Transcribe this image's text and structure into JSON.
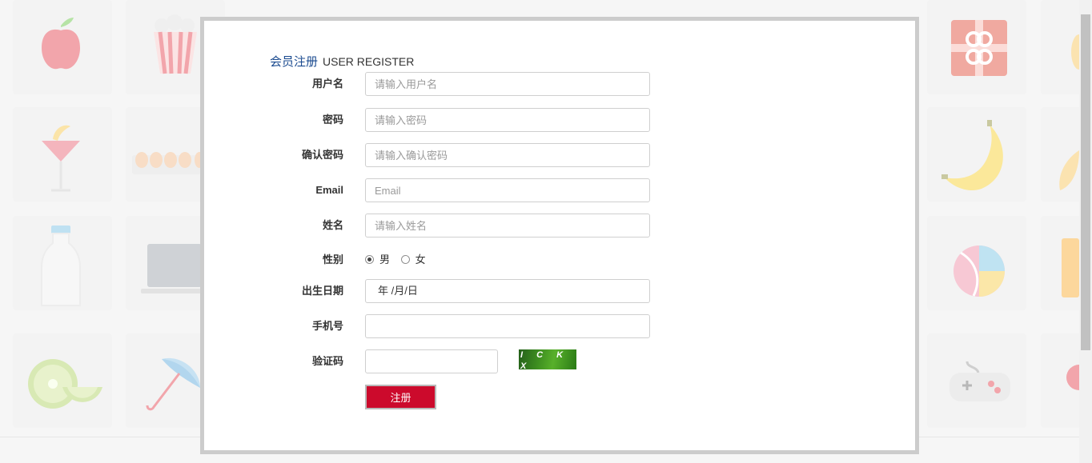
{
  "form": {
    "title_cn": "会员注册",
    "title_en": "USER REGISTER",
    "fields": {
      "username": {
        "label": "用户名",
        "placeholder": "请输入用户名"
      },
      "password": {
        "label": "密码",
        "placeholder": "请输入密码"
      },
      "confirm_password": {
        "label": "确认密码",
        "placeholder": "请输入确认密码"
      },
      "email": {
        "label": "Email",
        "placeholder": "Email"
      },
      "name": {
        "label": "姓名",
        "placeholder": "请输入姓名"
      },
      "gender": {
        "label": "性别",
        "options": [
          "男",
          "女"
        ],
        "selected": "男"
      },
      "birthdate": {
        "label": "出生日期",
        "value": "年 /月/日"
      },
      "phone": {
        "label": "手机号",
        "value": ""
      },
      "captcha": {
        "label": "验证码",
        "value": "",
        "image_text": "I C K X"
      }
    },
    "submit_label": "注册"
  },
  "colors": {
    "accent": "#cc0a2c",
    "title_blue": "#1a4a8f",
    "modal_border": "#cccccc",
    "captcha_green": "#3e8f20"
  },
  "background_icons": [
    "apple-icon",
    "popcorn-icon",
    "gift-icon",
    "cocktail-icon",
    "eggs-icon",
    "banana-icon",
    "milk-bottle-icon",
    "laptop-icon",
    "beach-ball-icon",
    "kiwi-icon",
    "umbrella-icon",
    "gamepad-icon"
  ]
}
